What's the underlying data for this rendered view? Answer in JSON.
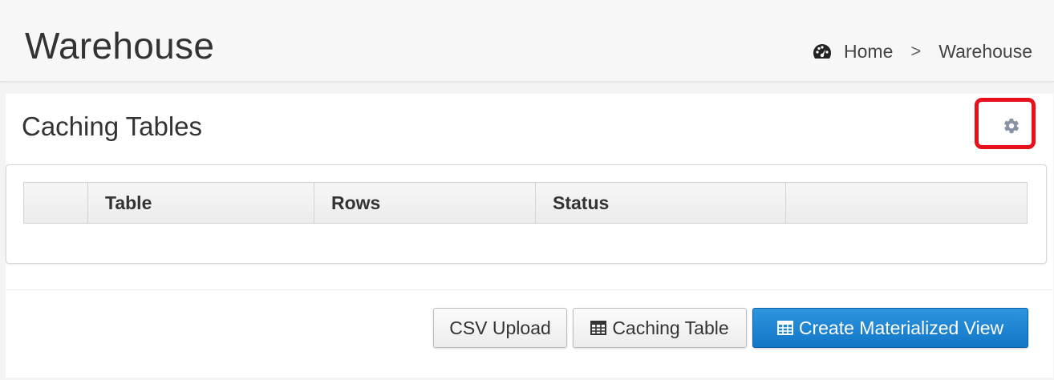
{
  "header": {
    "title": "Warehouse",
    "breadcrumb": {
      "home_label": "Home",
      "separator": ">",
      "current_label": "Warehouse"
    }
  },
  "panel": {
    "title": "Caching Tables",
    "settings_icon": "gear-icon",
    "table": {
      "columns": [
        "",
        "Table",
        "Rows",
        "Status",
        ""
      ],
      "rows": []
    }
  },
  "actions": {
    "csv_upload_label": "CSV Upload",
    "caching_table_label": "Caching Table",
    "create_view_label": "Create Materialized View"
  },
  "colors": {
    "primary": "#1a82d1",
    "highlight_box": "#e8101a"
  }
}
